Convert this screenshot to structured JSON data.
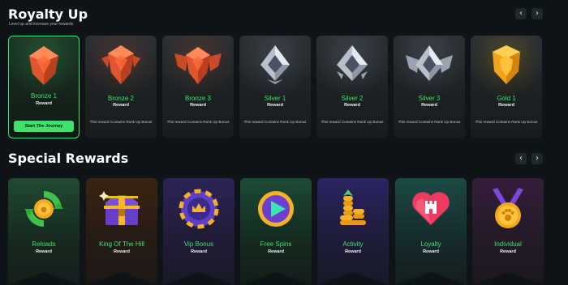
{
  "royalty": {
    "title": "Royalty Up",
    "subtitle": "Level up and increase your rewards",
    "prev_icon": "‹",
    "next_icon": "›",
    "start_button": "Start The Journey",
    "cards": [
      {
        "name": "Bronze 1",
        "sub": "Reward",
        "icon": "bronze-shield-icon"
      },
      {
        "name": "Bronze 2",
        "sub": "Reward",
        "desc": "This reward Contains Rank Up Bonus",
        "icon": "bronze-winged-shield-icon"
      },
      {
        "name": "Bronze 3",
        "sub": "Reward",
        "desc": "This reward Contains Rank Up Bonus",
        "icon": "bronze-winged-crest-icon"
      },
      {
        "name": "Silver 1",
        "sub": "Reward",
        "desc": "This reward Contains Rank Up Bonus",
        "icon": "silver-diamond-icon"
      },
      {
        "name": "Silver 2",
        "sub": "Reward",
        "desc": "This reward Contains Rank Up Bonus",
        "icon": "silver-diamond-icon"
      },
      {
        "name": "Silver 3",
        "sub": "Reward",
        "desc": "This reward Contains Rank Up Bonus",
        "icon": "silver-winged-diamond-icon"
      },
      {
        "name": "Gold 1",
        "sub": "Reward",
        "desc": "This reward Contains Rank Up Bonus",
        "icon": "gold-shield-icon"
      }
    ]
  },
  "special": {
    "title": "Special Rewards",
    "prev_icon": "‹",
    "next_icon": "›",
    "cards": [
      {
        "name": "Reloads",
        "sub": "Reward",
        "icon": "reload-coin-icon"
      },
      {
        "name": "King Of The Hill",
        "sub": "Reward",
        "icon": "treasure-chest-icon"
      },
      {
        "name": "Vip Bonus",
        "sub": "Reward",
        "icon": "vip-chip-icon"
      },
      {
        "name": "Free Spins",
        "sub": "Reward",
        "icon": "play-button-icon"
      },
      {
        "name": "Activity",
        "sub": "Reward",
        "icon": "coin-stack-icon"
      },
      {
        "name": "Loyalty",
        "sub": "Reward",
        "icon": "heart-castle-icon"
      },
      {
        "name": "Individual",
        "sub": "Reward",
        "icon": "paw-medal-icon"
      }
    ]
  },
  "colors": {
    "accent": "#3fe36b",
    "background": "#0e1417"
  }
}
